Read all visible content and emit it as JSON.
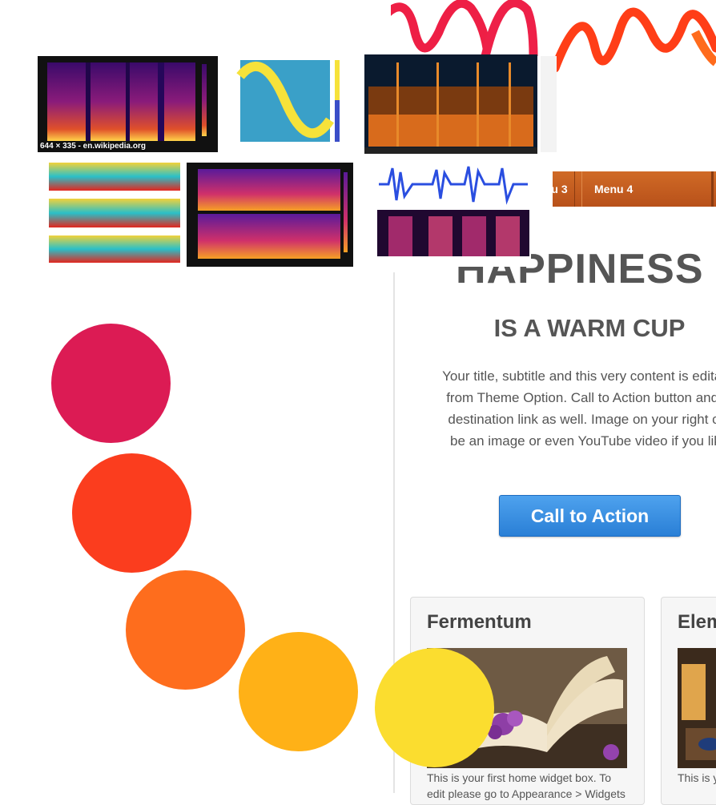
{
  "nav": {
    "items": [
      {
        "label": "u 3"
      },
      {
        "label": "Menu 4"
      }
    ]
  },
  "hero": {
    "title": "HAPPINESS",
    "subtitle": "IS A WARM CUP",
    "body": "Your title, subtitle and this very content is editable from Theme Option. Call to Action button and its destination link as well. Image on your right can be an image or even YouTube video if you like.",
    "cta_label": "Call to Action"
  },
  "widgets": [
    {
      "title": "Fermentum",
      "text": "This is your first home widget box. To edit please go to Appearance > Widgets"
    },
    {
      "title": "Elem",
      "text": "This is y To edit"
    }
  ],
  "thumbnails": {
    "spectrogram_1_caption": "644 × 335 - en.wikipedia.org"
  },
  "colors": {
    "circle_1": "#dc1b54",
    "circle_2": "#fb3d1e",
    "circle_3": "#fe6d1d",
    "circle_4": "#ffb117",
    "circle_5": "#fbdd2f",
    "nav_orange": "#c35d20",
    "cta_blue": "#3a8fe2"
  }
}
